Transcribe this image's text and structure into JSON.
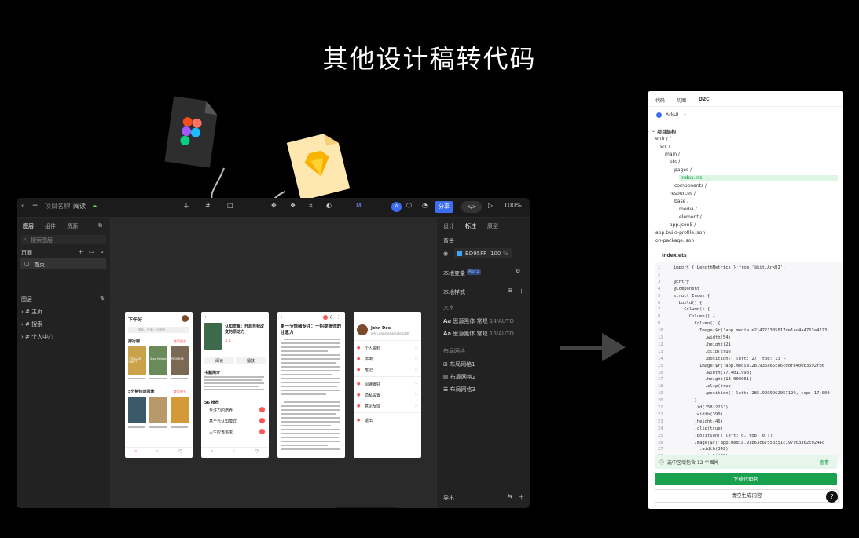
{
  "headline": "其他设计稿转代码",
  "tool": {
    "project_name": "项目名称",
    "page_name": "阅读",
    "share_label": "分享",
    "zoom": "100%",
    "avatar_letter": "A",
    "left_tabs": [
      "图层",
      "组件",
      "资源"
    ],
    "search_placeholder": "搜索图层",
    "pages_title": "页面",
    "page_item": "首页",
    "layers_title": "图层",
    "layers": [
      "主页",
      "搜索",
      "个人中心"
    ],
    "right_tabs": [
      "设计",
      "标注",
      "原型"
    ],
    "bg_title": "背景",
    "bg_hex": "BD95FF",
    "bg_opacity": "100",
    "bg_unit": "%",
    "local_vars": "本地变量",
    "beta": "Beta",
    "local_styles": "本地样式",
    "text_title": "文本",
    "text_styles": [
      {
        "name": "思源黑体 常规",
        "size": "14/AUTO"
      },
      {
        "name": "思源黑体 常规",
        "size": "16/AUTO"
      }
    ],
    "grid_title": "布局网格",
    "grids": [
      "布局网格1",
      "布局网格2",
      "布局网格3"
    ],
    "export_label": "导出",
    "code_btn": "</>"
  },
  "phones": {
    "p1": {
      "greeting": "下午好",
      "search": "搜索、作者、出版社",
      "rank": "排行榜",
      "rank_more": "查看更多",
      "rec": "5分钟快速阅读",
      "rec_more": "查看更多",
      "books": [
        "STELLAR DRIFT",
        "Stay Hidden",
        "PROMISE"
      ]
    },
    "p2": {
      "title": "认知觉醒：开启自我改变的原动力",
      "rating": "3.2",
      "btn_read": "阅读",
      "btn_listen": "播放",
      "summary_title": "书籍简介",
      "chapters": "56 推荐",
      "chap_items": [
        "专注力的培养",
        "基于元认知模式",
        "人生应该追求"
      ]
    },
    "p3": {
      "title": "第一节情绪专注：一招提振你的注意力"
    },
    "p4": {
      "name": "John Doe",
      "email": "john.doe@example.com",
      "menu": [
        "个人资料",
        "书架",
        "笔记",
        "阅读偏好",
        "隐私设置",
        "意见反馈",
        "退出"
      ]
    }
  },
  "code": {
    "tabs": [
      "代码",
      "切图",
      "D2C"
    ],
    "framework": "ArkUI",
    "tree_title": "项目结构",
    "tree": [
      {
        "label": "entry /",
        "depth": 0
      },
      {
        "label": "src /",
        "depth": 1
      },
      {
        "label": "main /",
        "depth": 2
      },
      {
        "label": "ets /",
        "depth": 3
      },
      {
        "label": "pages /",
        "depth": 4
      },
      {
        "label": "Index.ets",
        "depth": 5
      },
      {
        "label": "components /",
        "depth": 4
      },
      {
        "label": "resources /",
        "depth": 3
      },
      {
        "label": "base /",
        "depth": 4
      },
      {
        "label": "media /",
        "depth": 5
      },
      {
        "label": "element /",
        "depth": 5
      },
      {
        "label": "app.json5 /",
        "depth": 3
      },
      {
        "label": "app.build-profile.json",
        "depth": 0
      },
      {
        "label": "oh-package.json",
        "depth": 0
      }
    ],
    "file_tab": "Index.ets",
    "lines": [
      "import { LengthMetrics } from '@kit.ArkUI';",
      "",
      "@Entry",
      "@Component",
      "struct Index {",
      "  build() {",
      "    Column() {",
      "      Column() {",
      "        Column() {",
      "          Image($r('app.media.e214721385817de1ac4a4763a4273",
      "            .width(54)",
      "            .height(21)",
      "            .clip(true)",
      "            .position({ left: 27, top: 13 })",
      "          Image($r('app.media.281936a65ca6c0dfe400b3592fb6",
      "            .width(77.4011993)",
      "            .height(13.000061)",
      "            .clip(true)",
      "            .position({ left: 285.9999962057129, top: 17.000",
      "        }",
      "        .id('58:226')",
      "        .width(390)",
      "        .height(46)",
      "        .clip(true)",
      "        .position({ left: 0, top: 0 })",
      "        Image($r('app.media.91b63c6755b251c197903362c0244c",
      "          .width(342)",
      "          .height(60)"
    ],
    "info": "选中区域包含 12 个图片",
    "info_link": "查看",
    "download": "下载代码包",
    "clear": "清空生成内容",
    "help": "?"
  }
}
